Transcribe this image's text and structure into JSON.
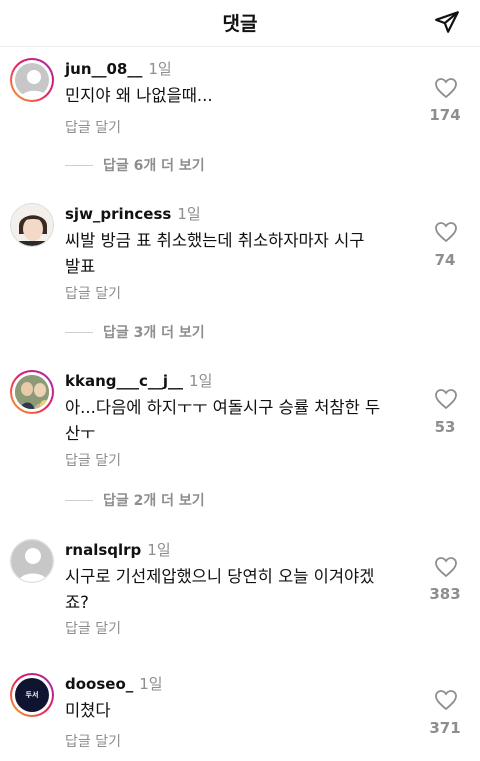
{
  "header": {
    "title": "댓글",
    "share_icon": "paper-plane-icon"
  },
  "comments": [
    {
      "username": "jun__08__",
      "time": "1일",
      "text_lines": [
        "민지야 왜 나없을때..."
      ],
      "reply_label": "답글 달기",
      "likes": "174",
      "more_replies": "답글 6개 더 보기",
      "avatar": "default-avatar"
    },
    {
      "username": "sjw_princess",
      "time": "1일",
      "text_lines": [
        "씨발 방금 표 취소했는데 취소하자마자 시구",
        "발표"
      ],
      "reply_label": "답글 달기",
      "likes": "74",
      "more_replies": "답글 3개 더 보기",
      "avatar": "photo-avatar"
    },
    {
      "username": "kkang___c__j__",
      "time": "1일",
      "text_lines": [
        "아...다음에 하지ㅜㅜ 여돌시구 승률 처참한 두",
        "산ㅜ"
      ],
      "reply_label": "답글 달기",
      "likes": "53",
      "more_replies": "답글 2개 더 보기",
      "avatar": "photo-avatar"
    },
    {
      "username": "rnalsqlrp",
      "time": "1일",
      "text_lines": [
        "시구로 기선제압했으니 당연히 오늘 이겨야겠",
        "죠?"
      ],
      "reply_label": "답글 달기",
      "likes": "383",
      "more_replies": "",
      "avatar": "default-avatar"
    },
    {
      "username": "dooseo_",
      "time": "1일",
      "text_lines": [
        "미쳤다"
      ],
      "reply_label": "답글 달기",
      "likes": "371",
      "more_replies": "",
      "avatar": "logo-avatar",
      "avatar_text": "두서"
    }
  ]
}
